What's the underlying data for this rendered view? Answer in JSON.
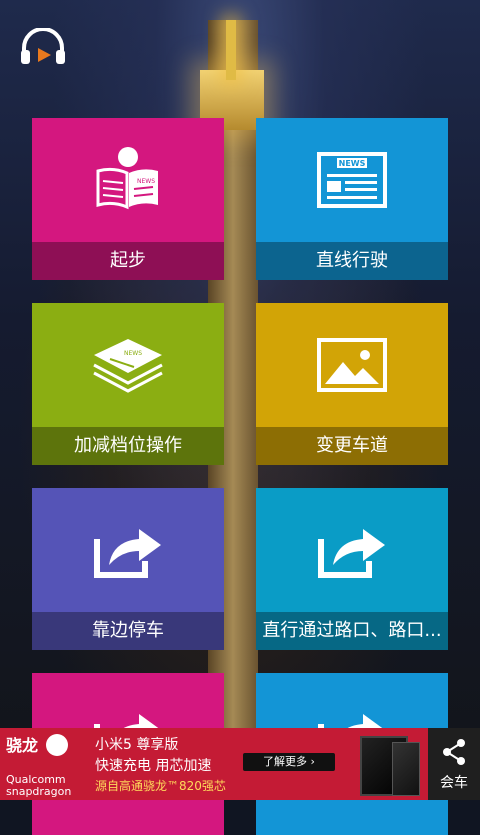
{
  "tiles": [
    {
      "label": "起步",
      "icon": "newspaper-reader-icon",
      "color": "#d4177f"
    },
    {
      "label": "直线行驶",
      "icon": "news-document-icon",
      "color": "#1395d6"
    },
    {
      "label": "加减档位操作",
      "icon": "newspaper-stack-icon",
      "color": "#8bae12"
    },
    {
      "label": "变更车道",
      "icon": "picture-icon",
      "color": "#d2a406"
    },
    {
      "label": "靠边停车",
      "icon": "share-arrow-icon",
      "color": "#5554b7"
    },
    {
      "label": "直行通过路口、路口...",
      "icon": "share-arrow-icon",
      "color": "#0a9cc6"
    },
    {
      "label": "",
      "icon": "share-arrow-icon",
      "color": "#d4177f"
    },
    {
      "label": "",
      "icon": "share-arrow-icon",
      "color": "#1395d6"
    }
  ],
  "icon_texts": {
    "news": "NEWS"
  },
  "ad": {
    "brand": "骁龙",
    "brand_sub1": "Qualcomm",
    "brand_sub2": "snapdragon",
    "line1": "小米5 尊享版",
    "line2": "快速充电 用芯加速",
    "line3": "源自高通骁龙™820强芯",
    "more": "了解更多 ›"
  },
  "share": {
    "label": "会车",
    "icon": "share-icon"
  }
}
